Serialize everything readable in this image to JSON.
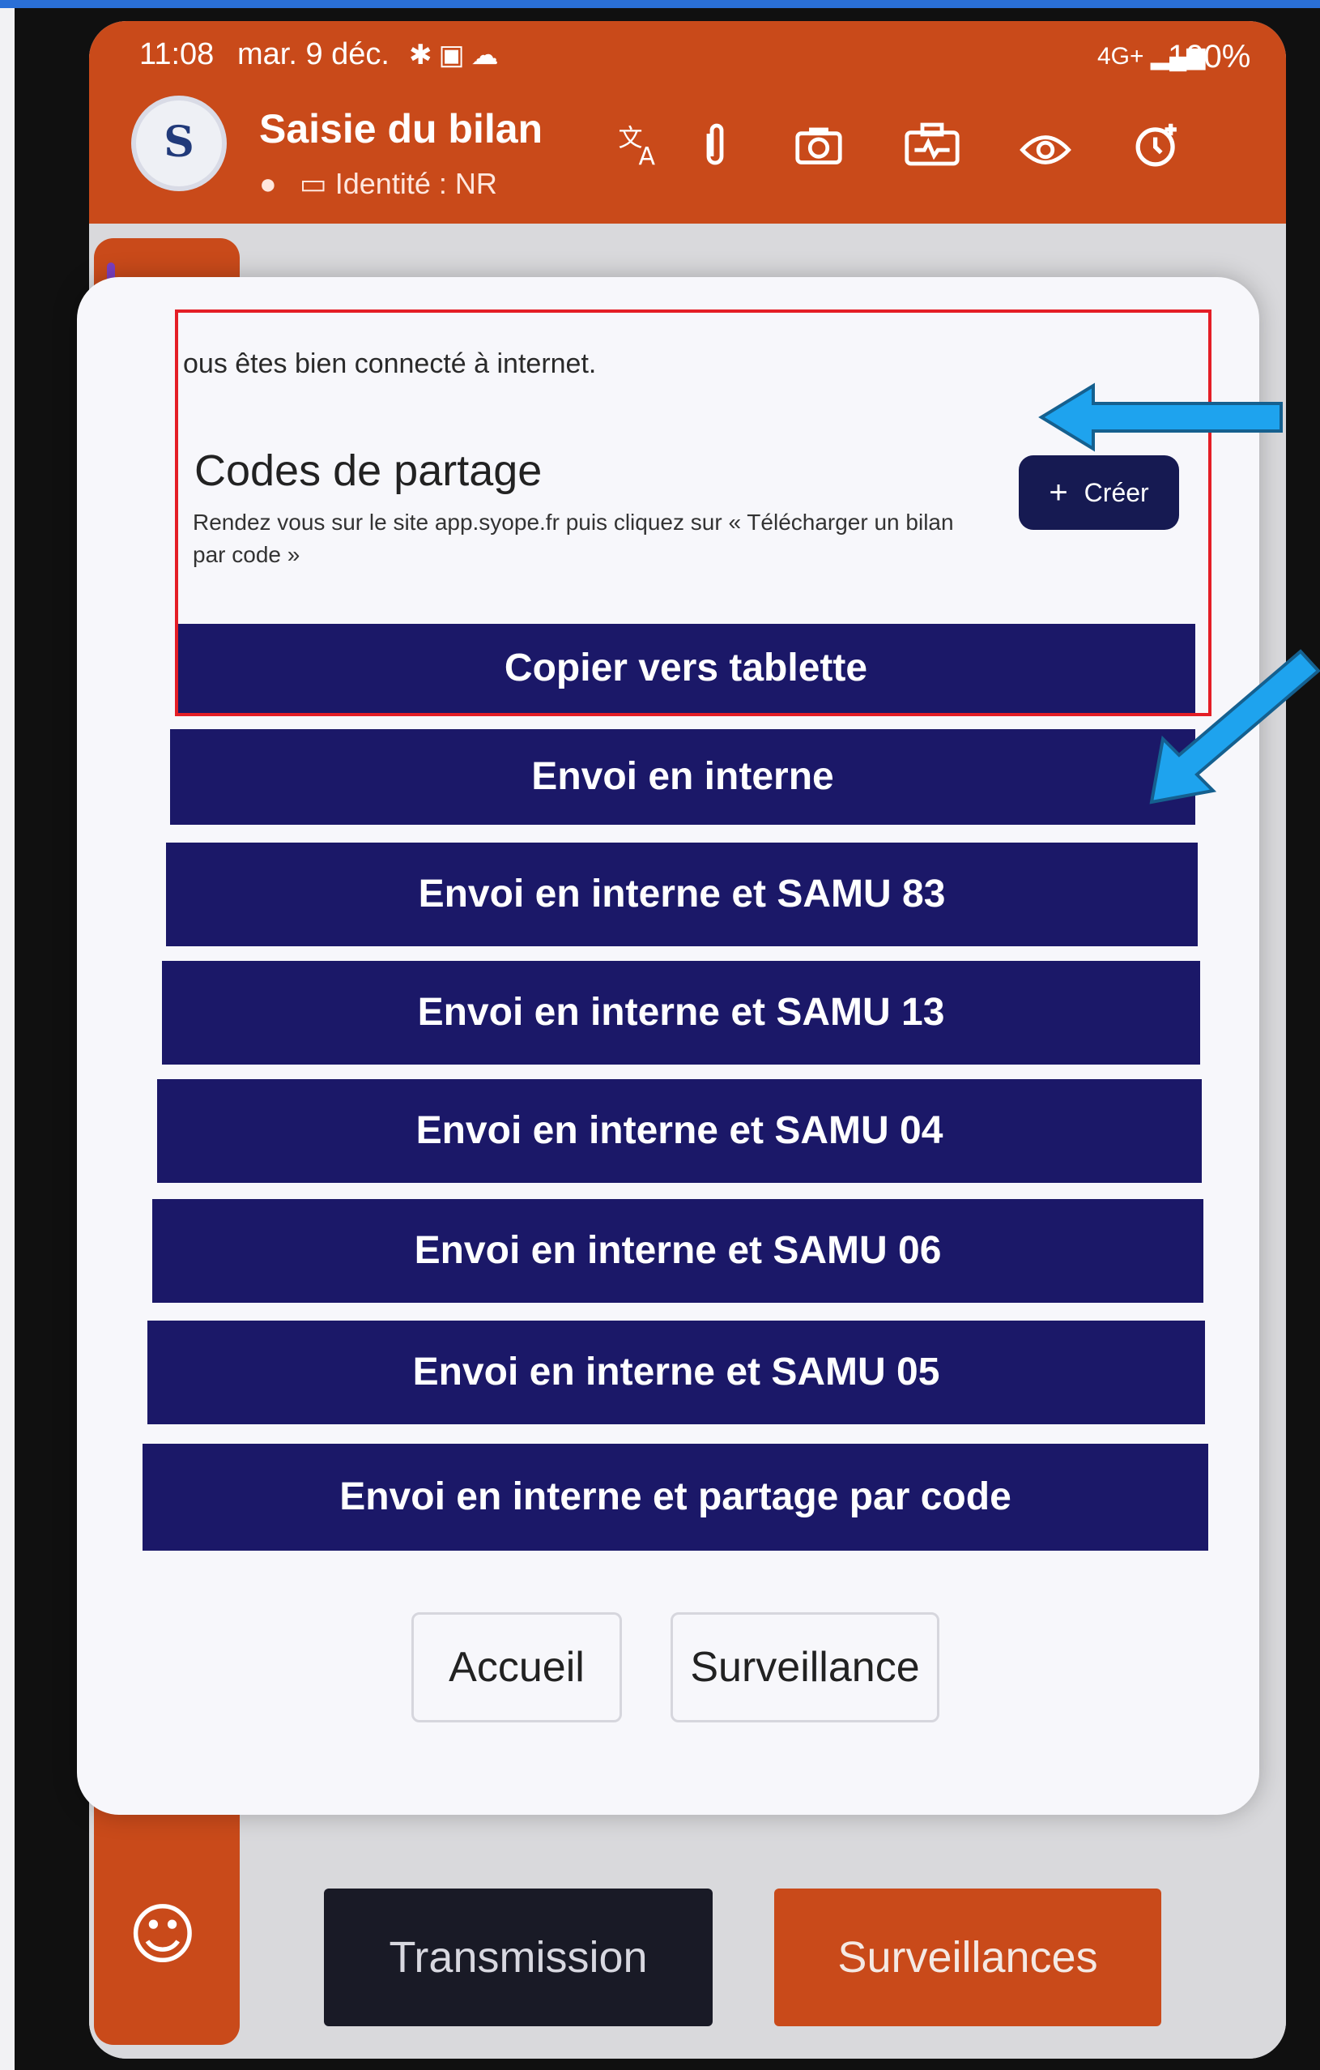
{
  "status_bar": {
    "time": "11:08",
    "date": "mar. 9 déc.",
    "network": "4G+",
    "battery": "100%"
  },
  "header": {
    "avatar_letter": "S",
    "title": "Saisie du bilan",
    "identity": "Identité : NR",
    "icons": [
      "translate-icon",
      "attachment-icon",
      "camera-icon",
      "medical-kit-icon",
      "eye-icon",
      "timer-add-icon"
    ]
  },
  "modal": {
    "notice": "ous êtes bien connecté à internet.",
    "sharing": {
      "title": "Codes de partage",
      "description": "Rendez vous sur le site app.syope.fr puis cliquez sur « Télécharger un bilan par code »",
      "create_label": "Créer"
    },
    "actions": [
      "Copier vers tablette",
      "Envoi en interne",
      "Envoi en interne et SAMU 83",
      "Envoi en interne et SAMU 13",
      "Envoi en interne et SAMU 04",
      "Envoi en interne et SAMU 06",
      "Envoi en interne et SAMU 05",
      "Envoi en interne et partage par code"
    ],
    "nav": {
      "home_label": "Accueil",
      "monitoring_label": "Surveillance"
    }
  },
  "bottom": {
    "transmission_label": "Transmission",
    "surveillances_label": "Surveillances"
  },
  "colors": {
    "app_orange": "#c94a1a",
    "action_navy": "#1b1868",
    "annotation_red": "#e41e26",
    "annotation_blue": "#1ea3ee"
  }
}
